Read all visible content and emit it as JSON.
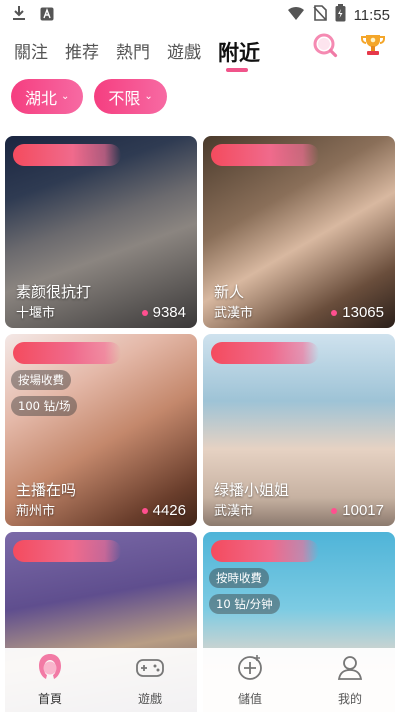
{
  "status_bar": {
    "time": "11:55",
    "icons": [
      "download-icon",
      "a-notification-icon",
      "wifi-icon",
      "no-sim-icon",
      "battery-charging-icon"
    ]
  },
  "tabs": [
    {
      "label": "關注"
    },
    {
      "label": "推荐"
    },
    {
      "label": "熱門"
    },
    {
      "label": "遊戲"
    },
    {
      "label": "附近"
    }
  ],
  "active_tab": "附近",
  "top_icons": [
    "search-icon",
    "trophy-icon"
  ],
  "filters": [
    {
      "label": "湖北"
    },
    {
      "label": "不限"
    }
  ],
  "cards": [
    {
      "name": "素颜很抗打",
      "city": "十堰市",
      "count": "9384",
      "tags": []
    },
    {
      "name": "新人",
      "city": "武漢市",
      "count": "13065",
      "tags": []
    },
    {
      "name": "主播在吗",
      "city": "荊州市",
      "count": "4426",
      "tags": [
        "按場收費",
        "100 钻/场"
      ]
    },
    {
      "name": "绿播小姐姐",
      "city": "武漢市",
      "count": "10017",
      "tags": []
    },
    {
      "name": "",
      "city": "",
      "count": "",
      "tags": []
    },
    {
      "name": "",
      "city": "",
      "count": "",
      "tags": [
        "按時收費",
        "10 钻/分钟"
      ]
    }
  ],
  "bottom_nav": [
    {
      "label": "首頁",
      "icon": "home-face-icon"
    },
    {
      "label": "遊戲",
      "icon": "gamepad-icon"
    },
    {
      "label": "儲值",
      "icon": "topup-icon"
    },
    {
      "label": "我的",
      "icon": "profile-icon"
    }
  ],
  "colors": {
    "accent": "#f0548a",
    "chip_start": "#f53e80",
    "chip_end": "#f76aa3",
    "count_dot": "#ff4f8f"
  }
}
